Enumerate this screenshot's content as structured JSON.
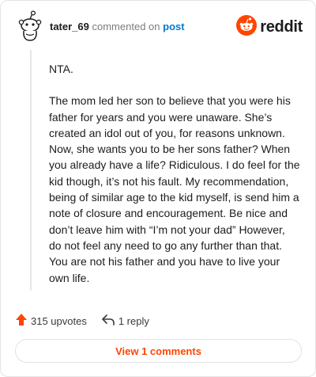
{
  "comment": {
    "username": "tater_69",
    "action_text": "commented on",
    "post_link": "post",
    "paragraphs": [
      "NTA.",
      "The mom led her son to believe that you were his father for years and you were unaware. She’s created an idol out of you, for reasons unknown. Now, she wants you to be her sons father? When you already have a life? Ridiculous. I do feel for the kid though, it’s not his fault. My recommendation, being of similar age to the kid myself, is send him a note of closure and encouragement. Be nice and don’t leave him with “I’m not your dad” However, do not feel any need to go any further than that. You are not his father and you have to live your own life."
    ]
  },
  "brand": {
    "wordmark": "reddit",
    "color": "#ff4500"
  },
  "actions": {
    "upvotes_label": "315 upvotes",
    "reply_label": "1 reply"
  },
  "footer": {
    "view_comments_label": "View 1 comments"
  },
  "icons": {
    "avatar": "snoo-avatar-icon",
    "logo": "reddit-logo-icon",
    "upvote": "upvote-arrow-icon",
    "reply": "reply-arrow-icon"
  },
  "colors": {
    "accent": "#ff4500",
    "link": "#0079d3",
    "muted": "#7c7c7c"
  }
}
